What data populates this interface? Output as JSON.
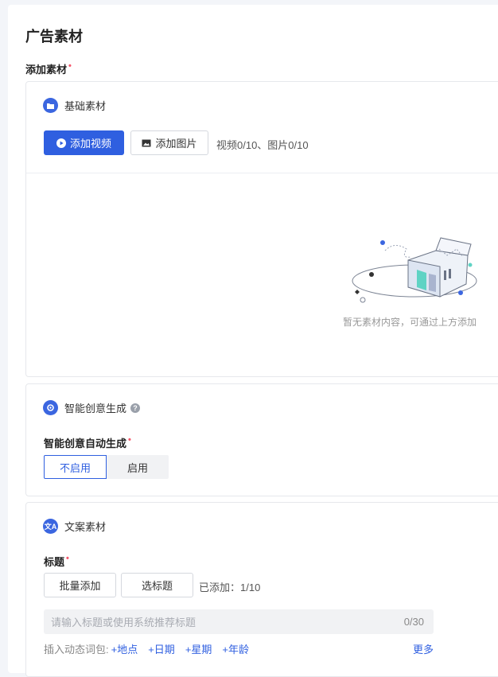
{
  "header": {
    "title": "广告素材"
  },
  "add_material": {
    "label": "添加素材",
    "required": "•"
  },
  "basic": {
    "title": "基础素材",
    "add_video": "添加视频",
    "add_image": "添加图片",
    "count": "视频0/10、图片0/10",
    "empty": "暂无素材内容，可通过上方添加"
  },
  "smart": {
    "title": "智能创意生成",
    "field_label": "智能创意自动生成",
    "options": [
      "不启用",
      "启用"
    ],
    "selected": "不启用"
  },
  "copy": {
    "title": "文案素材",
    "field_label": "标题",
    "batch_add": "批量添加",
    "select_title": "选标题",
    "added": "已添加：1/10",
    "placeholder": "请输入标题或使用系统推荐标题",
    "char_count": "0/30",
    "insert_label": "插入动态词包:",
    "tags": [
      "+地点",
      "+日期",
      "+星期",
      "+年龄"
    ],
    "more": "更多"
  },
  "colors": {
    "primary": "#2f5fe0",
    "required": "#f5576c",
    "panel": "#ffffff",
    "background": "#f3f5f9"
  }
}
